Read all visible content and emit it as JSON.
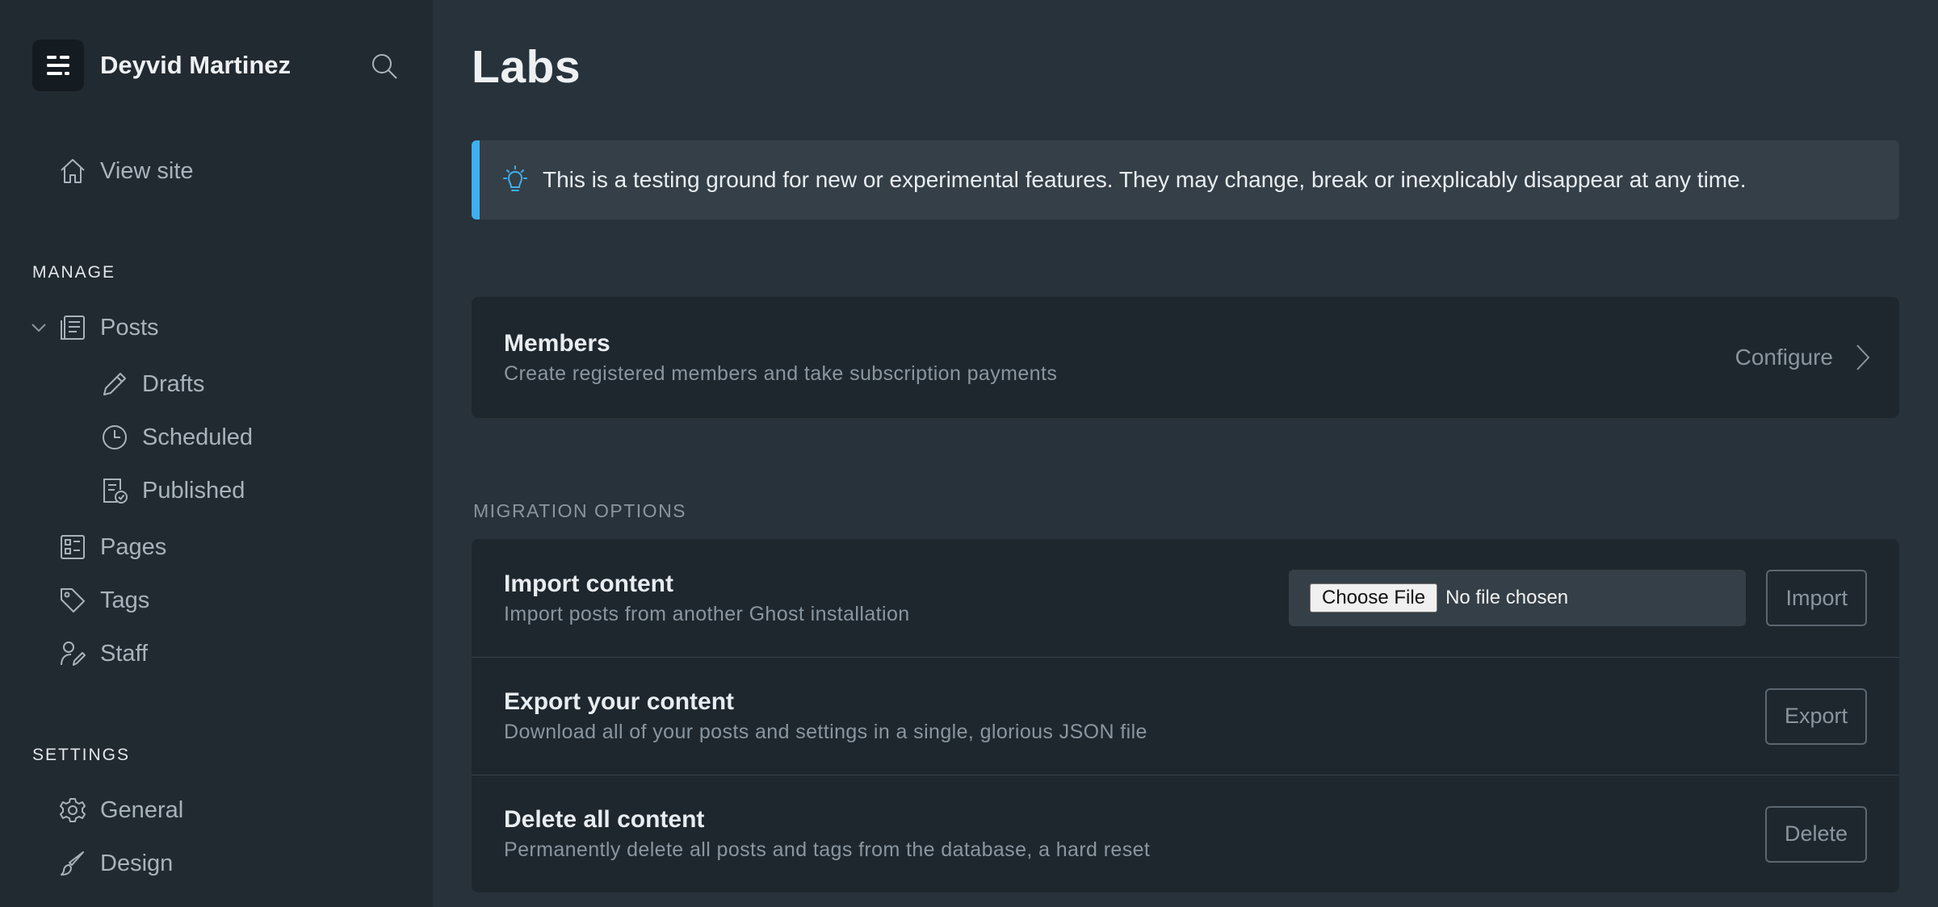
{
  "sidebar": {
    "brand_name": "Deyvid Martinez",
    "view_site": "View site",
    "manage_label": "MANAGE",
    "posts": "Posts",
    "drafts": "Drafts",
    "scheduled": "Scheduled",
    "published": "Published",
    "pages": "Pages",
    "tags": "Tags",
    "staff": "Staff",
    "settings_label": "SETTINGS",
    "general": "General",
    "design": "Design"
  },
  "main": {
    "title": "Labs",
    "notice": "This is a testing ground for new or experimental features. They may change, break or inexplicably disappear at any time.",
    "members": {
      "title": "Members",
      "desc": "Create registered members and take subscription payments",
      "action": "Configure"
    },
    "migration_heading": "MIGRATION OPTIONS",
    "import": {
      "title": "Import content",
      "desc": "Import posts from another Ghost installation",
      "choose_file": "Choose File",
      "file_status": "No file chosen",
      "button": "Import"
    },
    "export": {
      "title": "Export your content",
      "desc": "Download all of your posts and settings in a single, glorious JSON file",
      "button": "Export"
    },
    "delete": {
      "title": "Delete all content",
      "desc": "Permanently delete all posts and tags from the database, a hard reset",
      "button": "Delete"
    }
  },
  "colors": {
    "sidebar_bg": "#222a31",
    "main_bg": "#28323b",
    "card_bg": "#1f272e",
    "accent_blue": "#3eb0ef"
  }
}
